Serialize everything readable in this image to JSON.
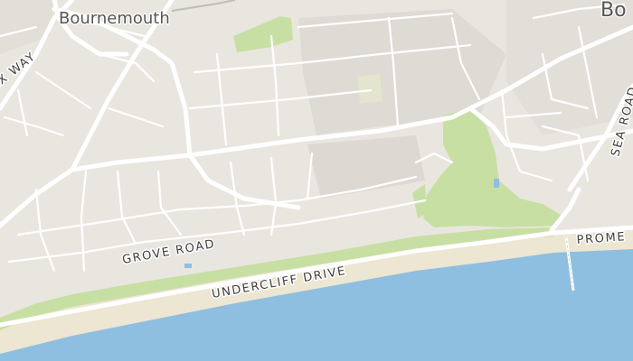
{
  "map": {
    "places": {
      "town": "Bournemouth",
      "town_edge": "Bo"
    },
    "roads": {
      "grove_road": "GROVE ROAD",
      "undercliff_drive": "UNDERCLIFF DRIVE",
      "sea_road": "SEA ROAD",
      "promenade": "PROME",
      "wessex_way": "EX WAY"
    },
    "colors": {
      "land": "#e9e6df",
      "urban": "#dedad4",
      "park": "#c8dfa4",
      "beach": "#ece6d2",
      "sea": "#8fbfe0",
      "road": "#ffffff"
    }
  }
}
